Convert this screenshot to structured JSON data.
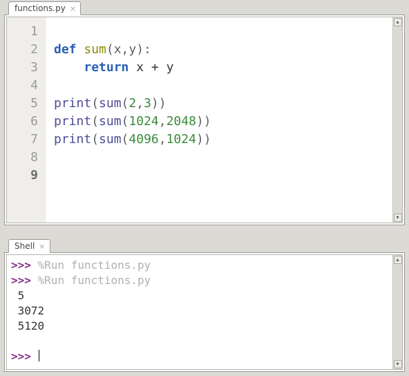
{
  "editor": {
    "tab": {
      "label": "functions.py"
    },
    "gutter": [
      "1",
      "2",
      "3",
      "4",
      "5",
      "6",
      "7",
      "8",
      "9"
    ],
    "currentLine": 9,
    "code": {
      "l1": "",
      "l2_def": "def",
      "l2_name": "sum",
      "l2_params": "(x,y):",
      "l3_return": "return",
      "l3_expr": " x + y",
      "l4": "",
      "l5_print": "print",
      "l5_sum": "sum",
      "l5_a": "2",
      "l5_b": "3",
      "l6_print": "print",
      "l6_sum": "sum",
      "l6_a": "1024",
      "l6_b": "2048",
      "l7_print": "print",
      "l7_sum": "sum",
      "l7_a": "4096",
      "l7_b": "1024",
      "l8": "",
      "l9": ""
    }
  },
  "shell": {
    "tab": {
      "label": "Shell"
    },
    "prompt": ">>>",
    "run1": " %Run functions.py",
    "run2": " %Run functions.py",
    "out1": " 5",
    "out2": " 3072",
    "out3": " 5120"
  }
}
